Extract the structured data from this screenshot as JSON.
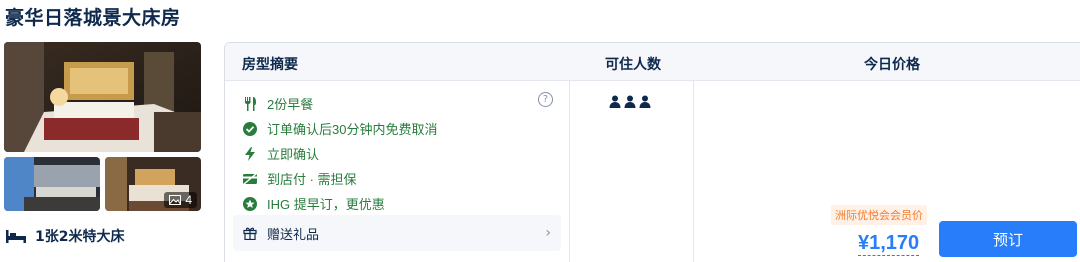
{
  "room": {
    "title": "豪华日落城景大床房",
    "photo_count": "4",
    "bed": "1张2米特大床"
  },
  "table": {
    "headers": {
      "summary": "房型摘要",
      "occupancy": "可住人数",
      "price": "今日价格"
    },
    "benefits": [
      {
        "icon": "fork-knife-icon",
        "text": "2份早餐"
      },
      {
        "icon": "check-circle-icon",
        "text": "订单确认后30分钟内免费取消"
      },
      {
        "icon": "lightning-icon",
        "text": "立即确认"
      },
      {
        "icon": "card-slash-icon",
        "text": "到店付 · 需担保"
      },
      {
        "icon": "ihg-star-icon",
        "text": "IHG 提早订，更优惠"
      }
    ],
    "gift": {
      "icon": "gift-icon",
      "text": "赠送礼品"
    },
    "occupancy_count": 3,
    "member_badge": "洲际优悦会会员价",
    "price": "¥1,170",
    "book_label": "预订"
  },
  "colors": {
    "accent": "#287dfa",
    "benefit_green": "#287d3c",
    "badge_orange": "#f27d2b",
    "text_dark": "#0f294d"
  }
}
